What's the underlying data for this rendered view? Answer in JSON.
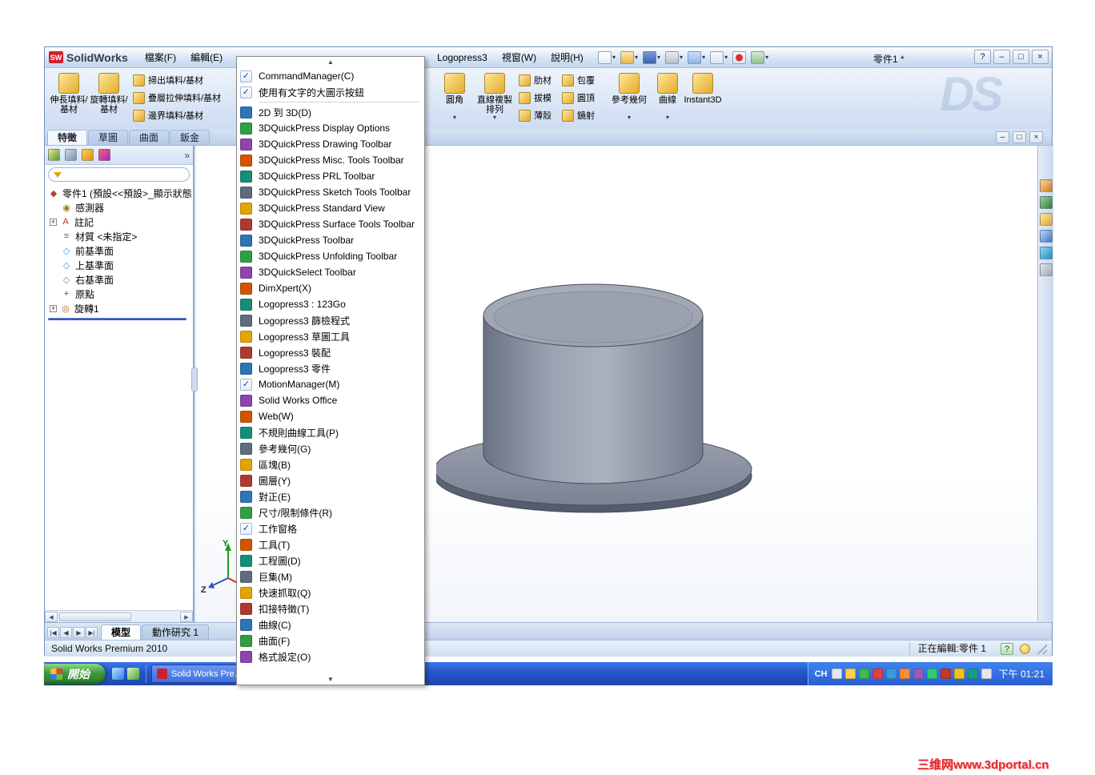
{
  "watermark": "三维网www.3dportal.cn",
  "glyphs": {
    "check": "✓",
    "dropdown": "▾",
    "up": "▲",
    "down": "▼",
    "left": "◀",
    "right": "▶",
    "first": "|◀",
    "last": "▶|",
    "chevron": "»",
    "plus": "+"
  },
  "titlebar": {
    "logo_sw": "SW",
    "logo_text": "SolidWorks",
    "doc_title": "零件1 *",
    "help_button": "?",
    "minimize": "–",
    "restore": "□",
    "close": "×"
  },
  "menu_bar": [
    "檔案(F)",
    "編輯(E)",
    "Logopress3",
    "視窗(W)",
    "說明(H)"
  ],
  "standard_toolbar": [
    {
      "icon": "new-document-icon",
      "dropdown": true
    },
    {
      "icon": "open-icon",
      "dropdown": true
    },
    {
      "icon": "save-icon",
      "dropdown": true
    },
    {
      "icon": "print-icon",
      "dropdown": true
    },
    {
      "icon": "undo-icon",
      "dropdown": true
    },
    {
      "icon": "select-icon",
      "dropdown": true
    },
    {
      "icon": "rebuild-icon",
      "dropdown": false
    },
    {
      "icon": "options-icon",
      "dropdown": true
    }
  ],
  "command_manager": {
    "large_left": [
      {
        "label": "伸長填料/基材",
        "icon": "extruded-boss-icon"
      },
      {
        "label": "旋轉填料/基材",
        "icon": "revolved-boss-icon"
      }
    ],
    "small_left": [
      {
        "label": "掃出填料/基材",
        "icon": "swept-boss-icon"
      },
      {
        "label": "疊層拉伸填料/基材",
        "icon": "lofted-boss-icon"
      },
      {
        "label": "邊界填料/基材",
        "icon": "boundary-boss-icon"
      }
    ],
    "large_mid": [
      {
        "label": "圓角",
        "icon": "fillet-icon",
        "dropdown": true
      },
      {
        "label": "直線複製排列",
        "icon": "linear-pattern-icon",
        "dropdown": true
      }
    ],
    "small_mid_a": [
      {
        "label": "肋材",
        "icon": "rib-icon"
      },
      {
        "label": "拔模",
        "icon": "draft-icon"
      },
      {
        "label": "薄殼",
        "icon": "shell-icon"
      }
    ],
    "small_mid_b": [
      {
        "label": "包覆",
        "icon": "wrap-icon"
      },
      {
        "label": "圓頂",
        "icon": "dome-icon"
      },
      {
        "label": "鏡射",
        "icon": "mirror-icon"
      }
    ],
    "large_right": [
      {
        "label": "參考幾何",
        "icon": "reference-geometry-icon",
        "dropdown": true
      },
      {
        "label": "曲線",
        "icon": "curves-icon",
        "dropdown": true
      }
    ],
    "instant3d": {
      "label": "Instant3D",
      "icon": "instant3d-icon"
    },
    "tabs": [
      {
        "label": "特徵",
        "active": true
      },
      {
        "label": "草圖",
        "active": false
      },
      {
        "label": "曲面",
        "active": false
      },
      {
        "label": "鈑金",
        "active": false
      }
    ],
    "ds_watermark": "DS"
  },
  "doc_window_controls": {
    "minimize": "–",
    "restore": "□",
    "close": "×"
  },
  "feature_panel": {
    "header_icons": [
      "feature-manager-tree-icon",
      "property-manager-icon",
      "configuration-manager-icon",
      "dimxpert-manager-icon"
    ],
    "header_chevron": "»",
    "root": {
      "label": "零件1 (預設<<預設>_顯示狀態",
      "icon": "part-icon"
    },
    "items": [
      {
        "label": "感測器",
        "icon": "sensors-icon",
        "expander": false
      },
      {
        "label": "註記",
        "icon": "annotations-icon",
        "expander": true
      },
      {
        "label": "材質 <未指定>",
        "icon": "material-icon",
        "expander": false
      },
      {
        "label": "前基準面",
        "icon": "plane-icon",
        "expander": false
      },
      {
        "label": "上基準面",
        "icon": "plane-icon",
        "expander": false
      },
      {
        "label": "右基準面",
        "icon": "plane-icon",
        "expander": false
      },
      {
        "label": "原點",
        "icon": "origin-icon",
        "expander": false
      },
      {
        "label": "旋轉1",
        "icon": "revolve-feature-icon",
        "expander": true
      }
    ]
  },
  "toolbars_menu": {
    "items": [
      {
        "label": "CommandManager(C)",
        "checked": true,
        "icon": "commandmanager-icon"
      },
      {
        "label": "使用有文字的大圖示按鈕",
        "checked": true,
        "icon": "large-buttons-with-text-icon"
      },
      {
        "label": "2D 到 3D(D)",
        "checked": false,
        "icon": "2d-to-3d-icon",
        "sep_before": true
      },
      {
        "label": "3DQuickPress Display Options",
        "checked": false,
        "icon": "quickpress-display-options-icon"
      },
      {
        "label": "3DQuickPress Drawing Toolbar",
        "checked": false,
        "icon": "quickpress-drawing-icon"
      },
      {
        "label": "3DQuickPress Misc. Tools Toolbar",
        "checked": false,
        "icon": "quickpress-misc-tools-icon"
      },
      {
        "label": "3DQuickPress PRL Toolbar",
        "checked": false,
        "icon": "quickpress-prl-icon"
      },
      {
        "label": "3DQuickPress Sketch Tools Toolbar",
        "checked": false,
        "icon": "quickpress-sketch-tools-icon"
      },
      {
        "label": "3DQuickPress Standard View",
        "checked": false,
        "icon": "quickpress-standard-view-icon"
      },
      {
        "label": "3DQuickPress Surface Tools Toolbar",
        "checked": false,
        "icon": "quickpress-surface-tools-icon"
      },
      {
        "label": "3DQuickPress Toolbar",
        "checked": false,
        "icon": "quickpress-toolbar-icon"
      },
      {
        "label": "3DQuickPress Unfolding Toolbar",
        "checked": false,
        "icon": "quickpress-unfolding-icon"
      },
      {
        "label": "3DQuickSelect Toolbar",
        "checked": false,
        "icon": "quickselect-toolbar-icon"
      },
      {
        "label": "DimXpert(X)",
        "checked": false,
        "icon": "dimxpert-icon"
      },
      {
        "label": "Logopress3 : 123Go",
        "checked": false,
        "icon": "logopress-123go-icon"
      },
      {
        "label": "Logopress3 篩檢程式",
        "checked": false,
        "icon": "logopress-filter-icon"
      },
      {
        "label": "Logopress3 草圖工具",
        "checked": false,
        "icon": "logopress-sketch-tools-icon"
      },
      {
        "label": "Logopress3 裝配",
        "checked": false,
        "icon": "logopress-assembly-icon"
      },
      {
        "label": "Logopress3 零件",
        "checked": false,
        "icon": "logopress-part-icon"
      },
      {
        "label": "MotionManager(M)",
        "checked": true,
        "icon": "motionmanager-icon"
      },
      {
        "label": "Solid Works Office",
        "checked": false,
        "icon": "solidworks-office-icon"
      },
      {
        "label": "Web(W)",
        "checked": false,
        "icon": "web-icon"
      },
      {
        "label": "不規則曲線工具(P)",
        "checked": false,
        "icon": "spline-tools-icon"
      },
      {
        "label": "參考幾何(G)",
        "checked": false,
        "icon": "reference-geometry-icon"
      },
      {
        "label": "區塊(B)",
        "checked": false,
        "icon": "blocks-icon"
      },
      {
        "label": "圖層(Y)",
        "checked": false,
        "icon": "layers-icon"
      },
      {
        "label": "對正(E)",
        "checked": false,
        "icon": "align-icon"
      },
      {
        "label": "尺寸/限制條件(R)",
        "checked": false,
        "icon": "dimensions-relations-icon"
      },
      {
        "label": "工作窗格",
        "checked": true,
        "icon": "task-pane-icon"
      },
      {
        "label": "工具(T)",
        "checked": false,
        "icon": "tools-icon"
      },
      {
        "label": "工程圖(D)",
        "checked": false,
        "icon": "drawing-icon"
      },
      {
        "label": "巨集(M)",
        "checked": false,
        "icon": "macro-icon"
      },
      {
        "label": "快速抓取(Q)",
        "checked": false,
        "icon": "quick-snaps-icon"
      },
      {
        "label": "扣接特徵(T)",
        "checked": false,
        "icon": "fastening-feature-icon"
      },
      {
        "label": "曲線(C)",
        "checked": false,
        "icon": "curves-icon"
      },
      {
        "label": "曲面(F)",
        "checked": false,
        "icon": "surfaces-icon"
      },
      {
        "label": "格式設定(O)",
        "checked": false,
        "icon": "formatting-icon"
      }
    ]
  },
  "task_pane_icons": [
    "solidworks-resources-icon",
    "design-library-icon",
    "file-explorer-icon",
    "view-palette-icon",
    "appearances-icon",
    "custom-properties-icon"
  ],
  "triad": {
    "y": "Y",
    "z": "Z"
  },
  "bottom_tabs": {
    "nav": [
      "|◀",
      "◀",
      "▶",
      "▶|"
    ],
    "tabs": [
      {
        "label": "模型",
        "active": true
      },
      {
        "label": "動作研究 1",
        "active": false
      }
    ]
  },
  "status_bar": {
    "product": "Solid Works Premium 2010",
    "editing": "正在編輯:零件 1",
    "help": "?"
  },
  "taskbar": {
    "start": "開始",
    "quick_launch": [
      "quick-launch-icon",
      "quick-launch-icon"
    ],
    "task": {
      "label": "Solid Works Premium ..."
    },
    "tray": {
      "lang": "CH",
      "icons": [
        "keyboard-icon",
        "help-icon",
        "tray-icon",
        "tray-icon",
        "tray-icon",
        "tray-icon",
        "tray-icon",
        "tray-icon",
        "tray-icon",
        "tray-icon",
        "tray-icon",
        "tray-icon"
      ],
      "time": "下午 01:21"
    }
  }
}
